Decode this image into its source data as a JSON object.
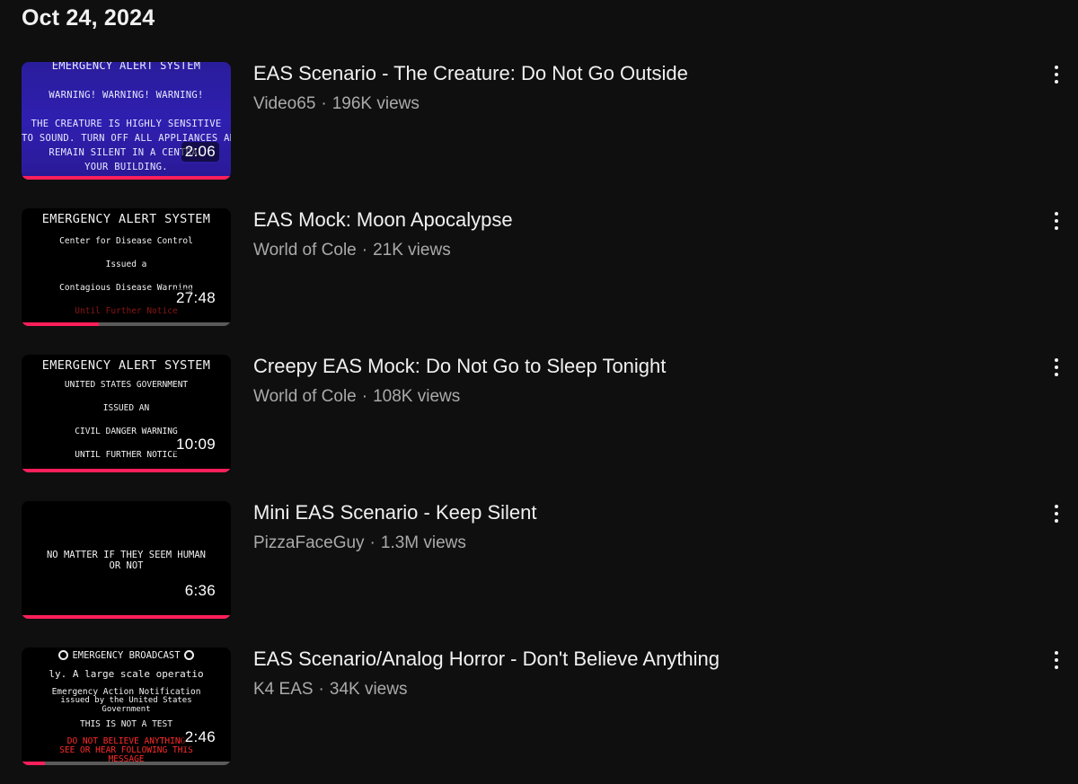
{
  "history": {
    "date_header": "Oct 24, 2024",
    "videos": [
      {
        "title": "EAS Scenario - The Creature: Do Not Go Outside",
        "channel": "Video65",
        "views": "196K views",
        "duration": "2:06",
        "progress_fraction": 1.0,
        "thumb_lines": [
          "EMERGENCY ALERT SYSTEM",
          "WARNING! WARNING! WARNING!",
          "THE CREATURE IS HIGHLY SENSITIVE",
          "TO SOUND. TURN OFF ALL APPLIANCES AND",
          "REMAIN SILENT IN A CENTRAL",
          "YOUR BUILDING."
        ]
      },
      {
        "title": "EAS Mock: Moon Apocalypse",
        "channel": "World of Cole",
        "views": "21K views",
        "duration": "27:48",
        "progress_fraction": 0.37,
        "thumb_lines": [
          "EMERGENCY ALERT SYSTEM",
          "Center for Disease Control",
          "Issued a",
          "Contagious Disease Warning",
          "Until Further Notice"
        ]
      },
      {
        "title": "Creepy EAS Mock: Do Not Go to Sleep Tonight",
        "channel": "World of Cole",
        "views": "108K views",
        "duration": "10:09",
        "progress_fraction": 1.0,
        "thumb_lines": [
          "EMERGENCY ALERT SYSTEM",
          "UNITED STATES GOVERNMENT",
          "ISSUED AN",
          "CIVIL DANGER WARNING",
          "UNTIL FURTHER NOTICE"
        ]
      },
      {
        "title": "Mini EAS Scenario - Keep Silent",
        "channel": "PizzaFaceGuy",
        "views": "1.3M views",
        "duration": "6:36",
        "progress_fraction": 1.0,
        "thumb_lines": [
          "NO MATTER IF THEY SEEM HUMAN",
          "OR NOT"
        ]
      },
      {
        "title": "EAS Scenario/Analog Horror - Don't Believe Anything",
        "channel": "K4 EAS",
        "views": "34K views",
        "duration": "2:46",
        "progress_fraction": 0.11,
        "thumb_lines": [
          "EMERGENCY BROADCAST",
          "ly. A large scale operatio",
          "Emergency Action Notification",
          "issued by the United States",
          "Government",
          "THIS IS NOT A TEST",
          "DO NOT BELIEVE ANYTHING",
          "SEE OR HEAR FOLLOWING THIS",
          "MESSAGE"
        ]
      }
    ]
  },
  "colors": {
    "background": "#0f0f0f",
    "progress_red": "#ff1f5a",
    "meta_gray": "#aaaaaa"
  },
  "icons": {
    "more_menu": "vertical-ellipsis-icon",
    "broadcast_seal": "circle-seal-icon"
  }
}
